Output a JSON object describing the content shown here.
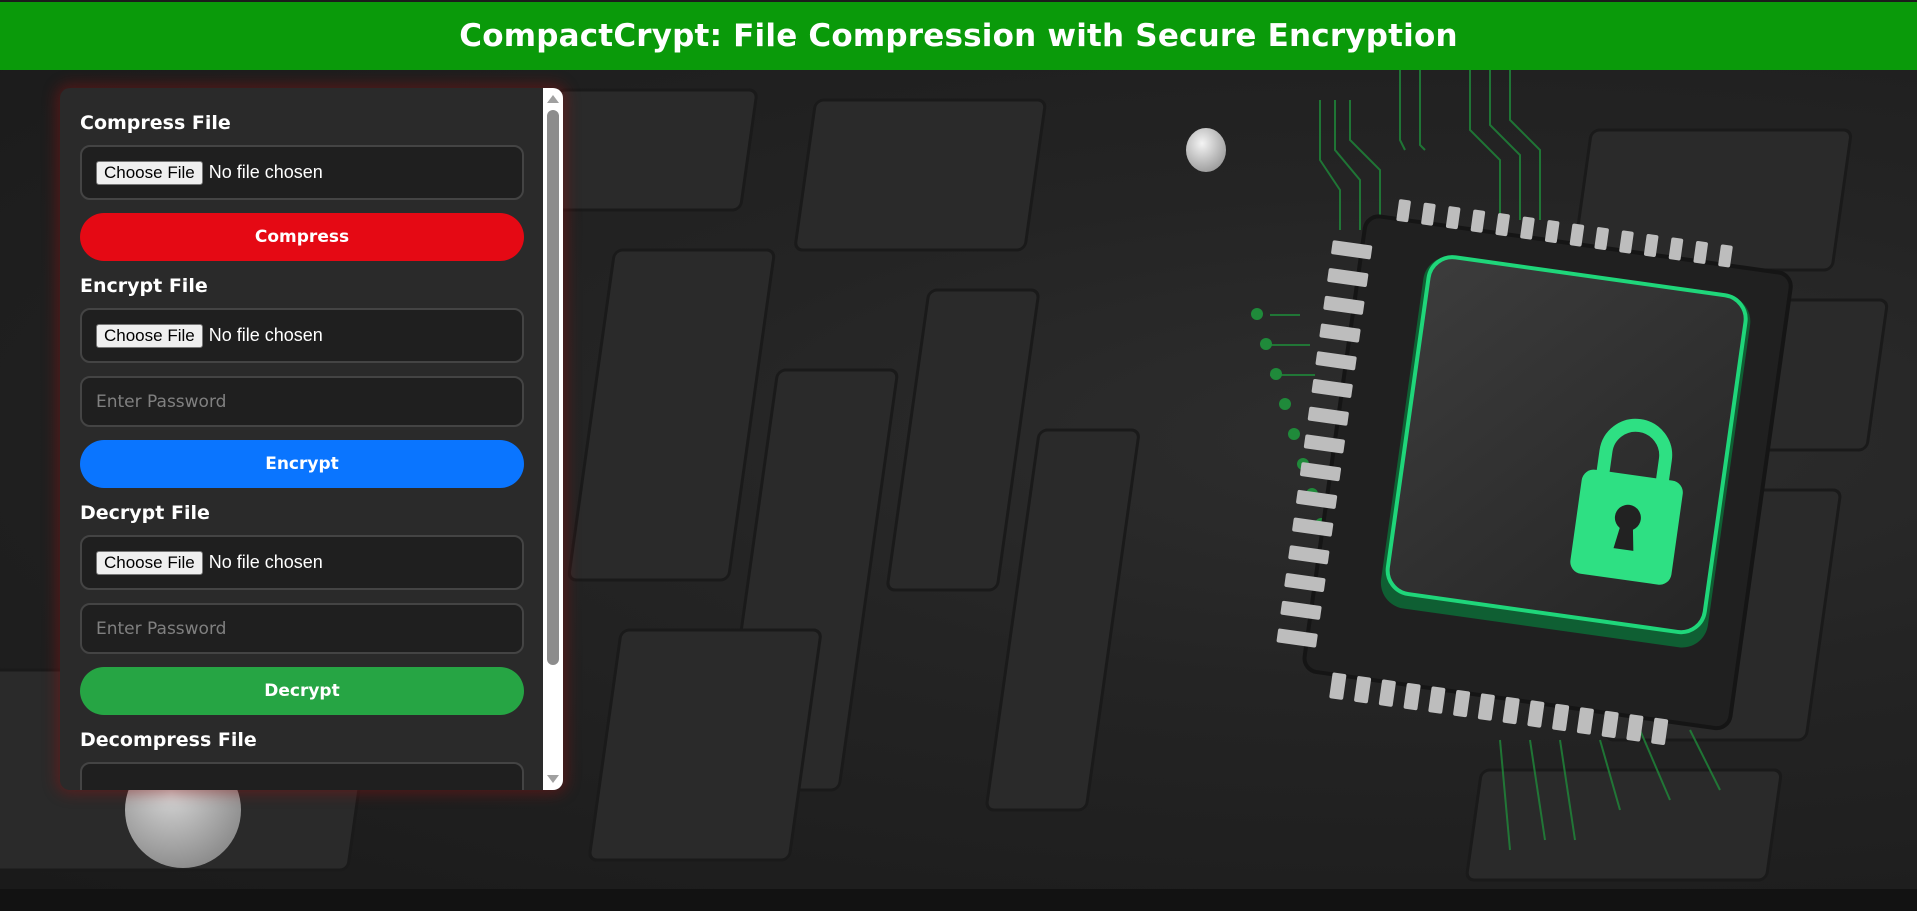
{
  "header": {
    "title": "CompactCrypt: File Compression with Secure Encryption"
  },
  "sections": {
    "compress": {
      "title": "Compress File",
      "file_button": "Choose File",
      "file_status": "No file chosen",
      "action_label": "Compress"
    },
    "encrypt": {
      "title": "Encrypt File",
      "file_button": "Choose File",
      "file_status": "No file chosen",
      "password_placeholder": "Enter Password",
      "action_label": "Encrypt"
    },
    "decrypt": {
      "title": "Decrypt File",
      "file_button": "Choose File",
      "file_status": "No file chosen",
      "password_placeholder": "Enter Password",
      "action_label": "Decrypt"
    },
    "decompress": {
      "title": "Decompress File"
    }
  },
  "colors": {
    "header_bg": "#0a9a0a",
    "compress_button": "#e50914",
    "encrypt_button": "#0a75ff",
    "decrypt_button": "#26a544",
    "panel_bg": "#2a2a2a",
    "chip_glow": "#1fd67a"
  },
  "icons": {
    "background": "circuit-board-chip-lock-image",
    "lock": "padlock-icon"
  }
}
